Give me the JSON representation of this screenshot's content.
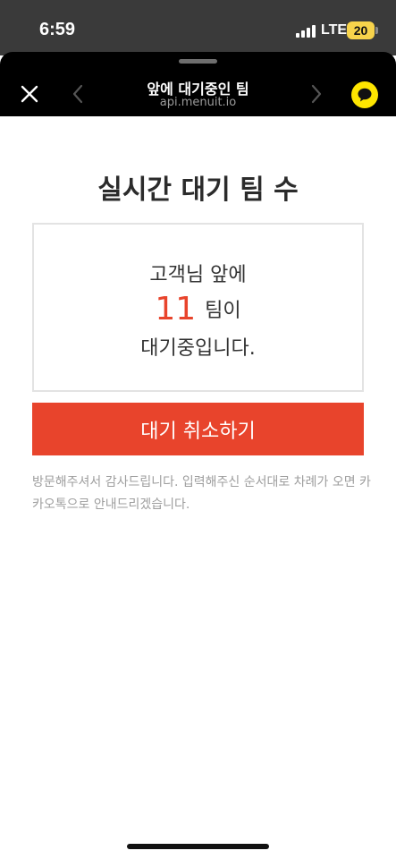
{
  "status_bar": {
    "time": "6:59",
    "network": "LTE",
    "battery": "20"
  },
  "header": {
    "title": "앞에 대기중인 팀",
    "url": "api.menuit.io",
    "close_icon": "close-icon",
    "back_icon": "chevron-left-icon",
    "forward_icon": "chevron-right-icon",
    "talk_icon": "kakaotalk-icon"
  },
  "main": {
    "title": "실시간 대기 팀 수",
    "box": {
      "line1": "고객님 앞에",
      "count": "11",
      "unit": "팀이",
      "line3": "대기중입니다."
    },
    "cancel_label": "대기 취소하기",
    "notice": "방문해주셔서 감사드립니다. 입력해주신 순서대로 차례가 오면 카카오톡으로 안내드리겠습니다."
  },
  "colors": {
    "accent": "#e8442c",
    "kakao_yellow": "#fee500",
    "header_bg": "#000000",
    "status_bg": "#3a3a3a"
  }
}
